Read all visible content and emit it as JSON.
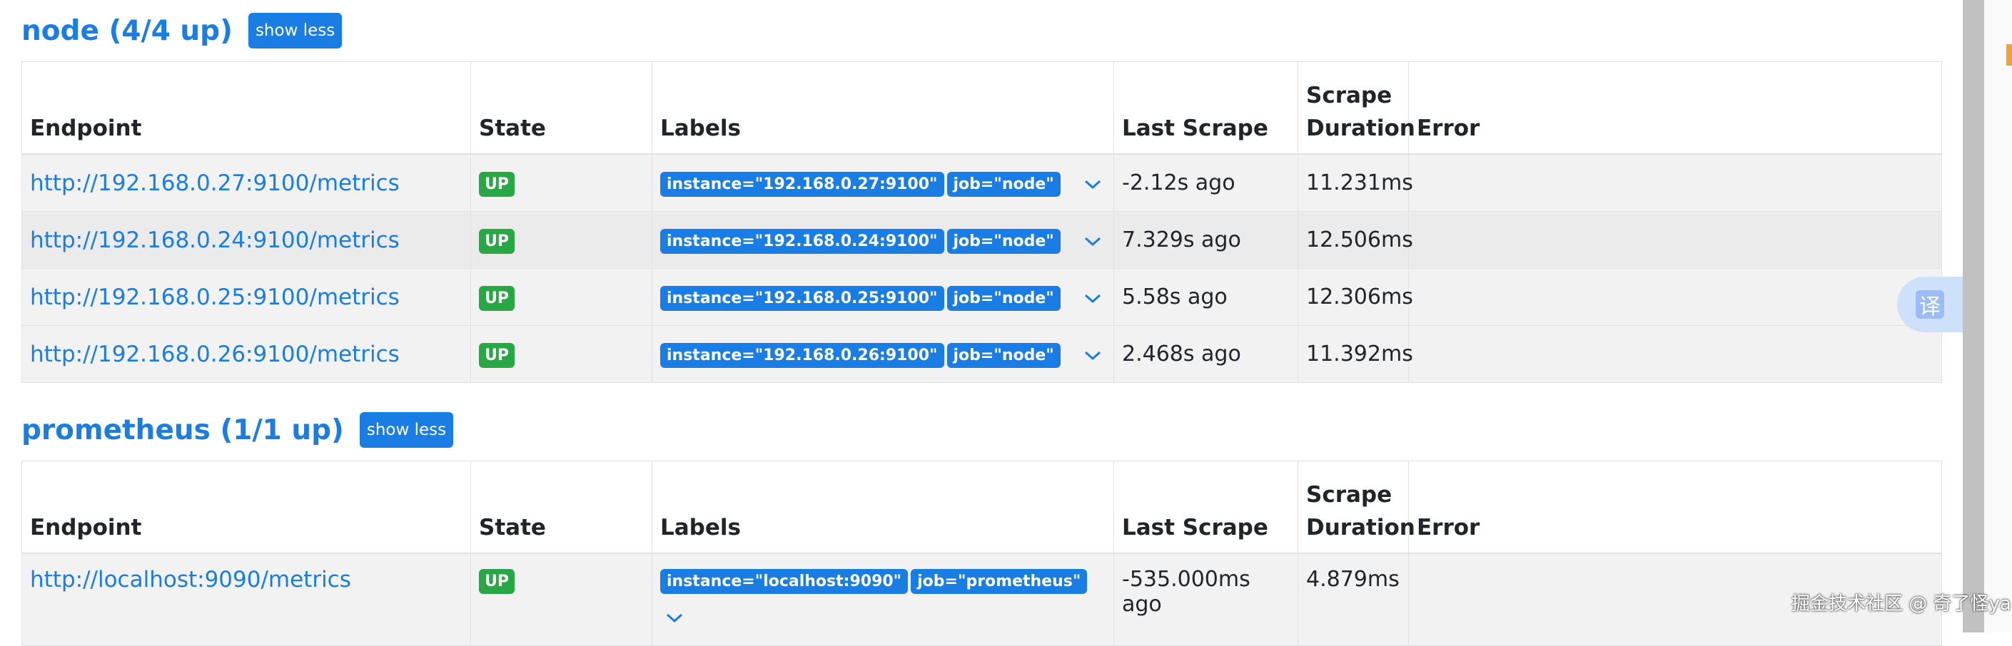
{
  "sections": {
    "node": {
      "title": "node (4/4 up)",
      "toggle_label": "show less",
      "columns": [
        "Endpoint",
        "State",
        "Labels",
        "Last Scrape",
        "Scrape Duration",
        "Error"
      ],
      "rows": [
        {
          "endpoint": "http://192.168.0.27:9100/metrics",
          "state": "UP",
          "label_instance": "instance=\"192.168.0.27:9100\"",
          "label_job": "job=\"node\"",
          "last_scrape": "-2.12s ago",
          "duration": "11.231ms",
          "error": ""
        },
        {
          "endpoint": "http://192.168.0.24:9100/metrics",
          "state": "UP",
          "label_instance": "instance=\"192.168.0.24:9100\"",
          "label_job": "job=\"node\"",
          "last_scrape": "7.329s ago",
          "duration": "12.506ms",
          "error": ""
        },
        {
          "endpoint": "http://192.168.0.25:9100/metrics",
          "state": "UP",
          "label_instance": "instance=\"192.168.0.25:9100\"",
          "label_job": "job=\"node\"",
          "last_scrape": "5.58s ago",
          "duration": "12.306ms",
          "error": ""
        },
        {
          "endpoint": "http://192.168.0.26:9100/metrics",
          "state": "UP",
          "label_instance": "instance=\"192.168.0.26:9100\"",
          "label_job": "job=\"node\"",
          "last_scrape": "2.468s ago",
          "duration": "11.392ms",
          "error": ""
        }
      ]
    },
    "prometheus": {
      "title": "prometheus (1/1 up)",
      "toggle_label": "show less",
      "columns": [
        "Endpoint",
        "State",
        "Labels",
        "Last Scrape",
        "Scrape Duration",
        "Error"
      ],
      "rows": [
        {
          "endpoint": "http://localhost:9090/metrics",
          "state": "UP",
          "label_instance": "instance=\"localhost:9090\"",
          "label_job": "job=\"prometheus\"",
          "last_scrape": "-535.000ms ago",
          "duration": "4.879ms",
          "error": ""
        }
      ]
    }
  },
  "overlay": {
    "translate_icon": "译",
    "watermark": "掘金技术社区 @ 奇了怪ya"
  },
  "colors": {
    "link": "#1a7de3",
    "up_badge": "#28a745",
    "label_badge": "#1a7de3",
    "row_odd": "#f2f2f2",
    "row_even": "#ebebeb"
  },
  "icons": [
    "chevron-down-icon",
    "translate-icon"
  ]
}
